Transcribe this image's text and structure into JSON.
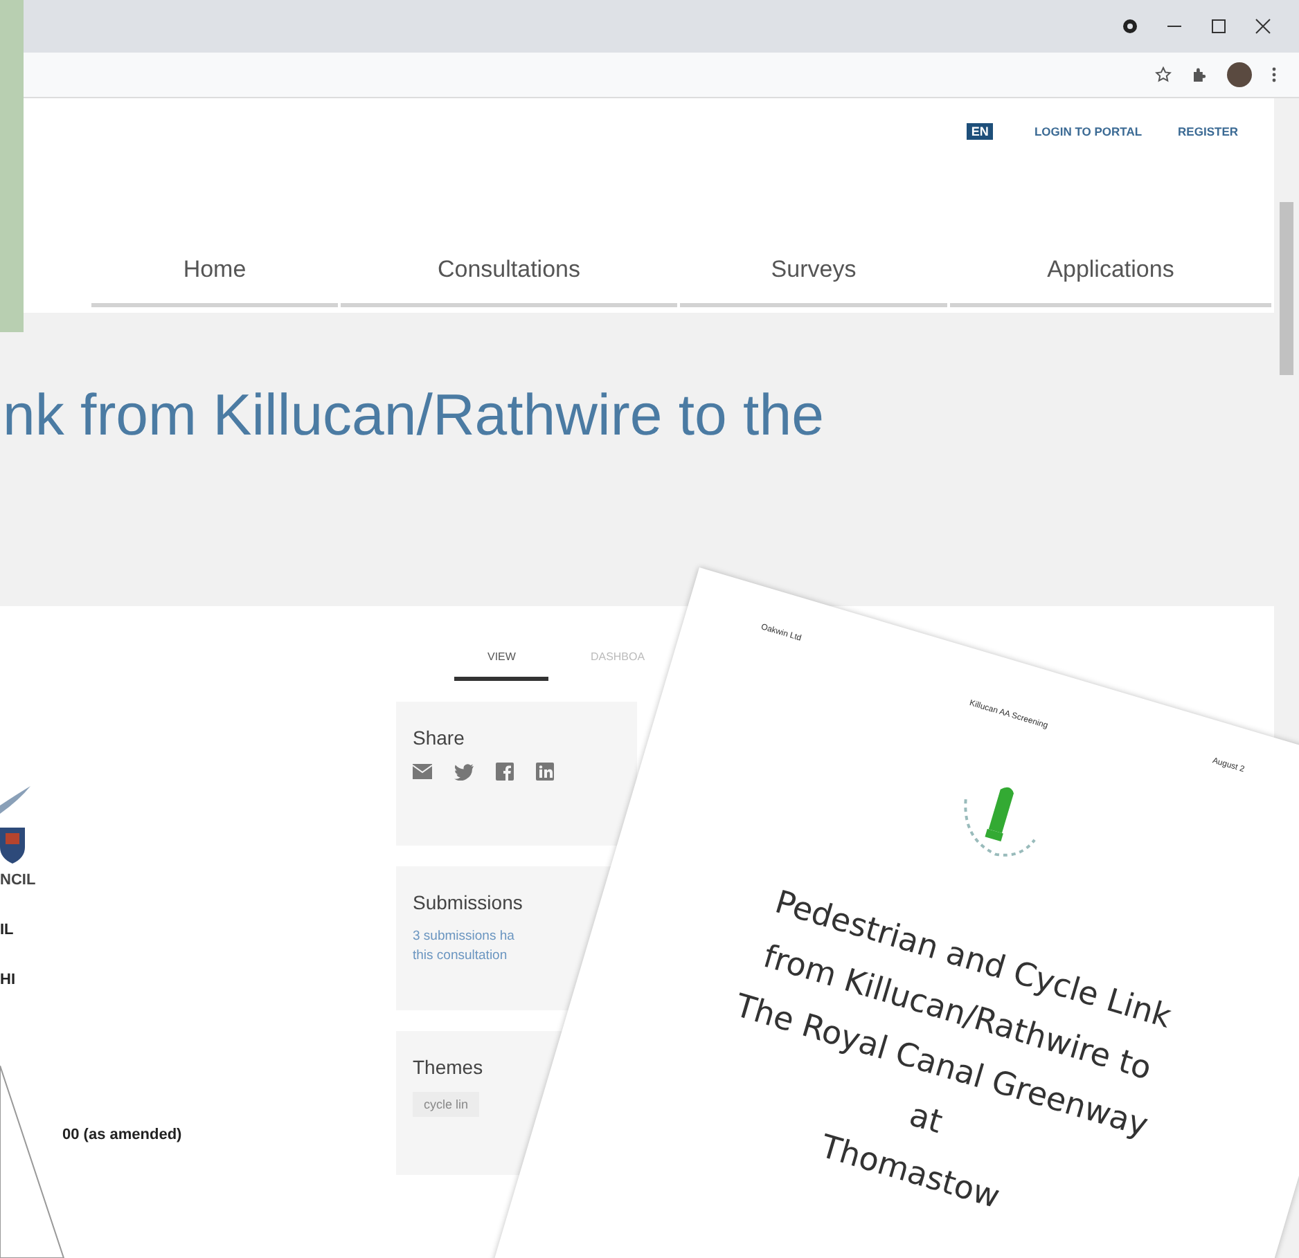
{
  "header_links": [
    {
      "label": "EN",
      "kind": "badge"
    },
    {
      "label": "LOGIN TO PORTAL",
      "kind": "link"
    },
    {
      "label": "REGISTER",
      "kind": "link"
    }
  ],
  "nav": [
    {
      "label": "Home"
    },
    {
      "label": "Consultations"
    },
    {
      "label": "Surveys"
    },
    {
      "label": "Applications"
    }
  ],
  "page_title": "nk from Killucan/Rathwire to the",
  "council": {
    "logo_text": "NCIL",
    "lines": [
      "IL",
      "HI"
    ],
    "footer_text": "00 (as amended)"
  },
  "tabs": [
    {
      "label": "VIEW",
      "selected": true
    },
    {
      "label": "DASHBOA",
      "selected": false
    }
  ],
  "panels": [
    {
      "kind": "share",
      "title": "Share"
    },
    {
      "kind": "text",
      "title": "Submissions",
      "lines": [
        "3 submissions ha",
        "this consultation"
      ]
    },
    {
      "kind": "tags",
      "title": "Themes",
      "tags": [
        "cycle lin"
      ]
    }
  ],
  "document": {
    "header_left": "Oakwin Ltd",
    "header_center": "Killucan AA Screening",
    "header_right": "August 2",
    "title_lines": [
      "Pedestrian and Cycle Link",
      "from Killucan/Rathwire to",
      "The Royal Canal Greenway",
      "at",
      "Thomastow"
    ]
  }
}
